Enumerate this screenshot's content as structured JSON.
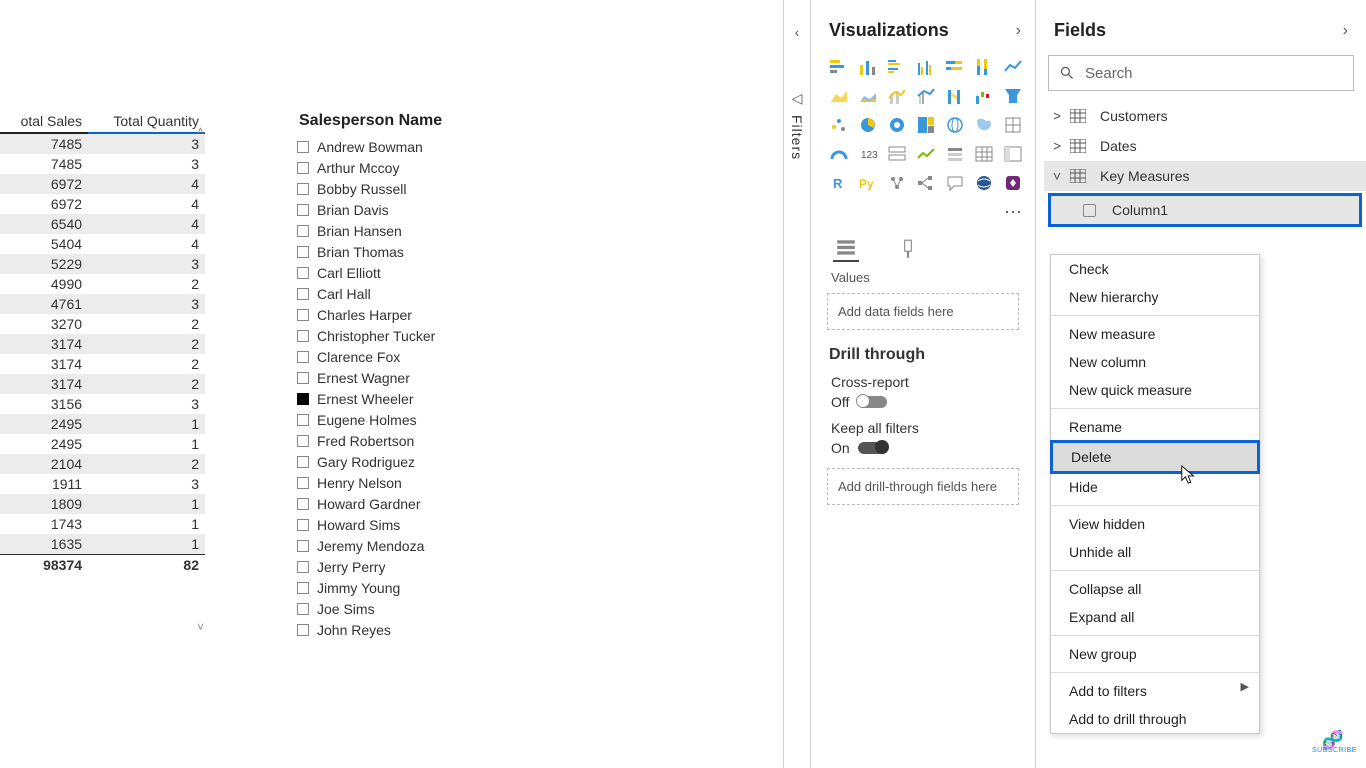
{
  "columns": {
    "col1": "otal Sales",
    "col2": "Total Quantity"
  },
  "rows": [
    {
      "sales": "7485",
      "qty": "3"
    },
    {
      "sales": "7485",
      "qty": "3"
    },
    {
      "sales": "6972",
      "qty": "4"
    },
    {
      "sales": "6972",
      "qty": "4"
    },
    {
      "sales": "6540",
      "qty": "4"
    },
    {
      "sales": "5404",
      "qty": "4"
    },
    {
      "sales": "5229",
      "qty": "3"
    },
    {
      "sales": "4990",
      "qty": "2"
    },
    {
      "sales": "4761",
      "qty": "3"
    },
    {
      "sales": "3270",
      "qty": "2"
    },
    {
      "sales": "3174",
      "qty": "2"
    },
    {
      "sales": "3174",
      "qty": "2"
    },
    {
      "sales": "3174",
      "qty": "2"
    },
    {
      "sales": "3156",
      "qty": "3"
    },
    {
      "sales": "2495",
      "qty": "1"
    },
    {
      "sales": "2495",
      "qty": "1"
    },
    {
      "sales": "2104",
      "qty": "2"
    },
    {
      "sales": "1911",
      "qty": "3"
    },
    {
      "sales": "1809",
      "qty": "1"
    },
    {
      "sales": "1743",
      "qty": "1"
    },
    {
      "sales": "1635",
      "qty": "1"
    }
  ],
  "totals": {
    "sales": "98374",
    "qty": "82"
  },
  "slicer": {
    "title": "Salesperson Name",
    "items": [
      {
        "label": "Andrew Bowman",
        "checked": false
      },
      {
        "label": "Arthur Mccoy",
        "checked": false
      },
      {
        "label": "Bobby Russell",
        "checked": false
      },
      {
        "label": "Brian Davis",
        "checked": false
      },
      {
        "label": "Brian Hansen",
        "checked": false
      },
      {
        "label": "Brian Thomas",
        "checked": false
      },
      {
        "label": "Carl Elliott",
        "checked": false
      },
      {
        "label": "Carl Hall",
        "checked": false
      },
      {
        "label": "Charles Harper",
        "checked": false
      },
      {
        "label": "Christopher Tucker",
        "checked": false
      },
      {
        "label": "Clarence Fox",
        "checked": false
      },
      {
        "label": "Ernest Wagner",
        "checked": false
      },
      {
        "label": "Ernest Wheeler",
        "checked": true
      },
      {
        "label": "Eugene Holmes",
        "checked": false
      },
      {
        "label": "Fred Robertson",
        "checked": false
      },
      {
        "label": "Gary Rodriguez",
        "checked": false
      },
      {
        "label": "Henry Nelson",
        "checked": false
      },
      {
        "label": "Howard Gardner",
        "checked": false
      },
      {
        "label": "Howard Sims",
        "checked": false
      },
      {
        "label": "Jeremy Mendoza",
        "checked": false
      },
      {
        "label": "Jerry Perry",
        "checked": false
      },
      {
        "label": "Jimmy Young",
        "checked": false
      },
      {
        "label": "Joe Sims",
        "checked": false
      },
      {
        "label": "John Reyes",
        "checked": false
      }
    ]
  },
  "filters": {
    "tab": "Filters"
  },
  "viz": {
    "title": "Visualizations",
    "values_label": "Values",
    "values_well": "Add data fields here",
    "drill_title": "Drill through",
    "cross_label": "Cross-report",
    "cross_state": "Off",
    "keep_label": "Keep all filters",
    "keep_state": "On",
    "drill_well": "Add drill-through fields here"
  },
  "fields": {
    "title": "Fields",
    "search_placeholder": "Search",
    "tables": [
      {
        "name": "Customers",
        "expanded": false
      },
      {
        "name": "Dates",
        "expanded": false
      },
      {
        "name": "Key Measures",
        "expanded": true,
        "selected": true,
        "items": [
          {
            "name": "Column1",
            "highlight": true
          }
        ]
      }
    ]
  },
  "menu": {
    "items": [
      {
        "label": "Check"
      },
      {
        "label": "New hierarchy"
      },
      {
        "label": "New measure",
        "sep": true
      },
      {
        "label": "New column"
      },
      {
        "label": "New quick measure"
      },
      {
        "label": "Rename",
        "sep": true
      },
      {
        "label": "Delete",
        "highlight": true
      },
      {
        "label": "Hide"
      },
      {
        "label": "View hidden",
        "sep": true
      },
      {
        "label": "Unhide all"
      },
      {
        "label": "Collapse all",
        "sep": true
      },
      {
        "label": "Expand all"
      },
      {
        "label": "New group",
        "sep": true
      },
      {
        "label": "Add to filters",
        "sep": true,
        "submenu": true
      },
      {
        "label": "Add to drill through"
      }
    ]
  },
  "badge": "SUBSCRIBE"
}
